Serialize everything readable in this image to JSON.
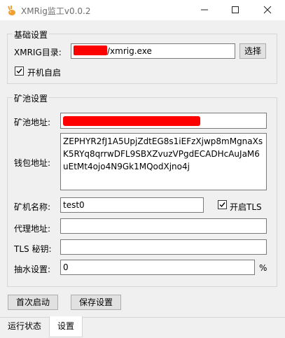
{
  "window": {
    "title": "XMRig监工v0.0.2",
    "icon": "rabbit-icon"
  },
  "basic": {
    "group_title": "基础设置",
    "xmrig_dir_label": "XMRIG目录:",
    "xmrig_dir_value": "/xmrig.exe",
    "browse_label": "选择",
    "autostart_label": "开机自启",
    "autostart_checked": true
  },
  "pool": {
    "group_title": "矿池设置",
    "pool_address_label": "矿池地址:",
    "wallet_label": "钱包地址:",
    "wallet_value": "ZEPHYR2fJ1A5UpjZdtEG8s1iEFzXjwp8mMgnaXsK5RYq8qrrwDFL9SBXZvuzVPgdECADHcAuJaM6uEtMt4ojo4N9Gk1MQodXjno4j",
    "miner_name_label": "矿机名称:",
    "miner_name_value": "test0",
    "tls_label": "开启TLS",
    "tls_checked": true,
    "proxy_label": "代理地址:",
    "tls_key_label": "TLS 秘钥:",
    "fee_label": "抽水设置:",
    "fee_value": "0",
    "fee_unit": "%"
  },
  "actions": {
    "first_start_label": "首次启动",
    "save_label": "保存设置"
  },
  "tabs": [
    {
      "label": "运行状态",
      "active": false
    },
    {
      "label": "设置",
      "active": true
    }
  ],
  "colors": {
    "redaction": "#ff0000",
    "window_bg": "#f0f0f0"
  }
}
